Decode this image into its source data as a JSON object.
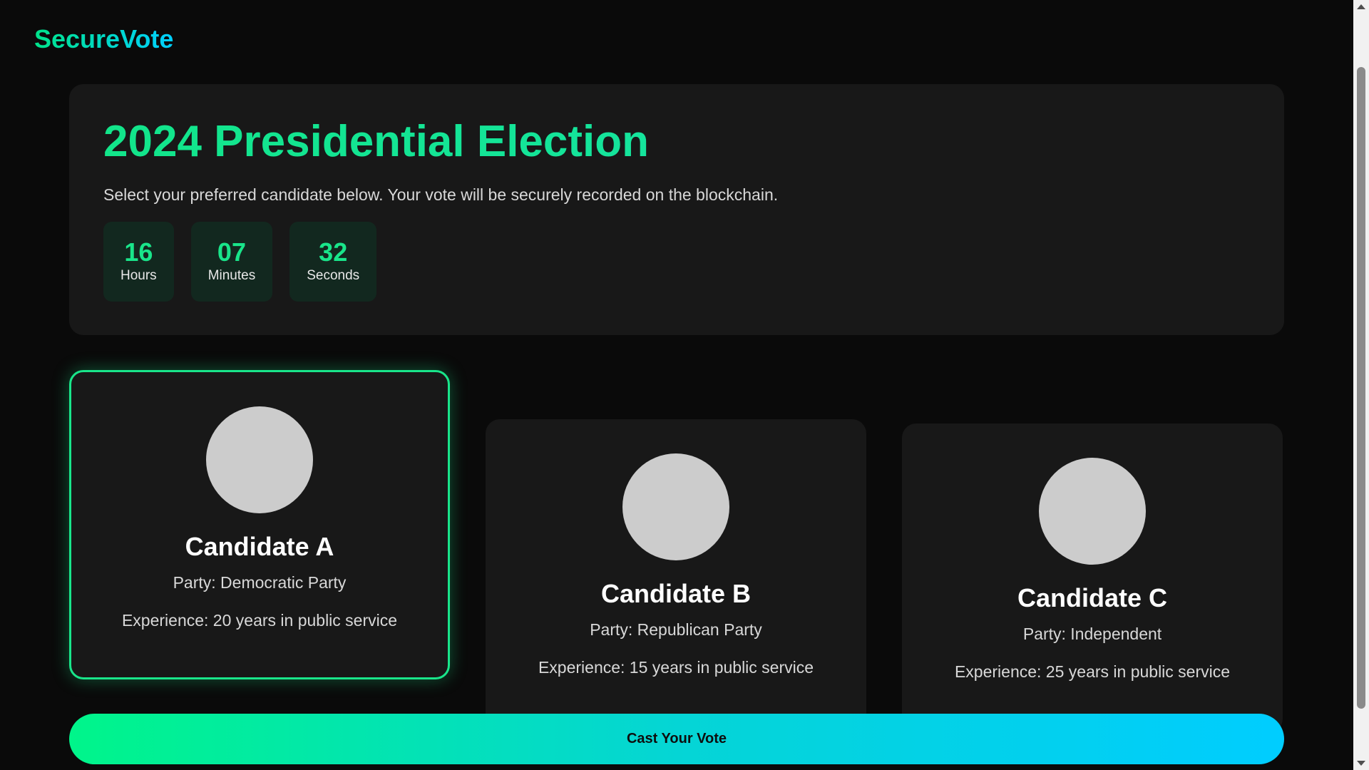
{
  "header": {
    "logo": "SecureVote"
  },
  "election": {
    "title": "2024 Presidential Election",
    "description": "Select your preferred candidate below. Your vote will be securely recorded on the blockchain.",
    "timer": [
      {
        "value": "16",
        "label": "Hours"
      },
      {
        "value": "07",
        "label": "Minutes"
      },
      {
        "value": "32",
        "label": "Seconds"
      }
    ]
  },
  "candidates": [
    {
      "name": "Candidate A",
      "party": "Party: Democratic Party",
      "experience": "Experience: 20 years in public service",
      "selected": true
    },
    {
      "name": "Candidate B",
      "party": "Party: Republican Party",
      "experience": "Experience: 15 years in public service",
      "selected": false
    },
    {
      "name": "Candidate C",
      "party": "Party: Independent",
      "experience": "Experience: 25 years in public service",
      "selected": false
    }
  ],
  "actions": {
    "cast_vote": "Cast Your Vote"
  },
  "colors": {
    "accent": "#19e58a",
    "accent_secondary": "#00cfff",
    "background": "#0a0a0a",
    "card": "#181818"
  }
}
